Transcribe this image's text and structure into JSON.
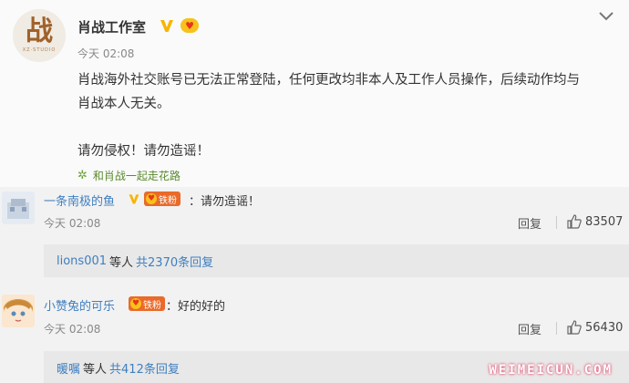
{
  "post": {
    "author": "肖战工作室",
    "avatar_glyph": "战",
    "avatar_caption": "XZ·STUDIO",
    "time": "今天 02:08",
    "text": "肖战海外社交账号已无法正常登陆，任何更改均非本人及工作人员操作，后续动作均与肖战本人无关。",
    "text2": "请勿侵权！请勿造谣！",
    "topic": "和肖战一起走花路",
    "icons": [
      "verified-v-icon",
      "vip-heart-icon",
      "chevron-down-icon",
      "flower-icon"
    ]
  },
  "comments": [
    {
      "name": "一条南极的鱼",
      "fan_label": "铁粉",
      "text": "：请勿造谣！",
      "time": "今天 02:08",
      "reply_label": "回复",
      "likes": "83507",
      "sub_user": "lions001",
      "sub_mid": "等人",
      "sub_count": "共2370条回复"
    },
    {
      "name": "小赞兔的可乐",
      "fan_label": "铁粉",
      "text": "：好的好的",
      "time": "今天 02:08",
      "reply_label": "回复",
      "likes": "56430",
      "sub_user": "暖嘱",
      "sub_mid": "等人",
      "sub_count": "共412条回复"
    }
  ],
  "watermark": "WEIMEICUN.COM",
  "colors": {
    "link": "#3f7fc0",
    "fan_badge": "#e96a2a",
    "verified": "#f7b500",
    "topic": "#5a8a2e"
  }
}
